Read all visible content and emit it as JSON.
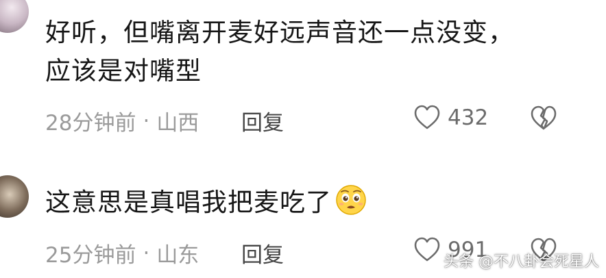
{
  "comments": [
    {
      "text_line1": "好听，但嘴离开麦好远声音还一点没变，",
      "text_line2": "应该是对嘴型",
      "time": "28分钟前",
      "separator": "·",
      "location": "山西",
      "reply_label": "回复",
      "likes": "432"
    },
    {
      "text": "这意思是真唱我把麦吃了",
      "emoji_icon": "pleading-face-icon",
      "time": "25分钟前",
      "separator": "·",
      "location": "山东",
      "reply_label": "回复",
      "likes": "991"
    }
  ],
  "watermark": "头条 @不八卦会死星人",
  "colors": {
    "meta_gray": "#9a9a9a",
    "text": "#161616",
    "icon_gray": "#6b6b6b"
  }
}
